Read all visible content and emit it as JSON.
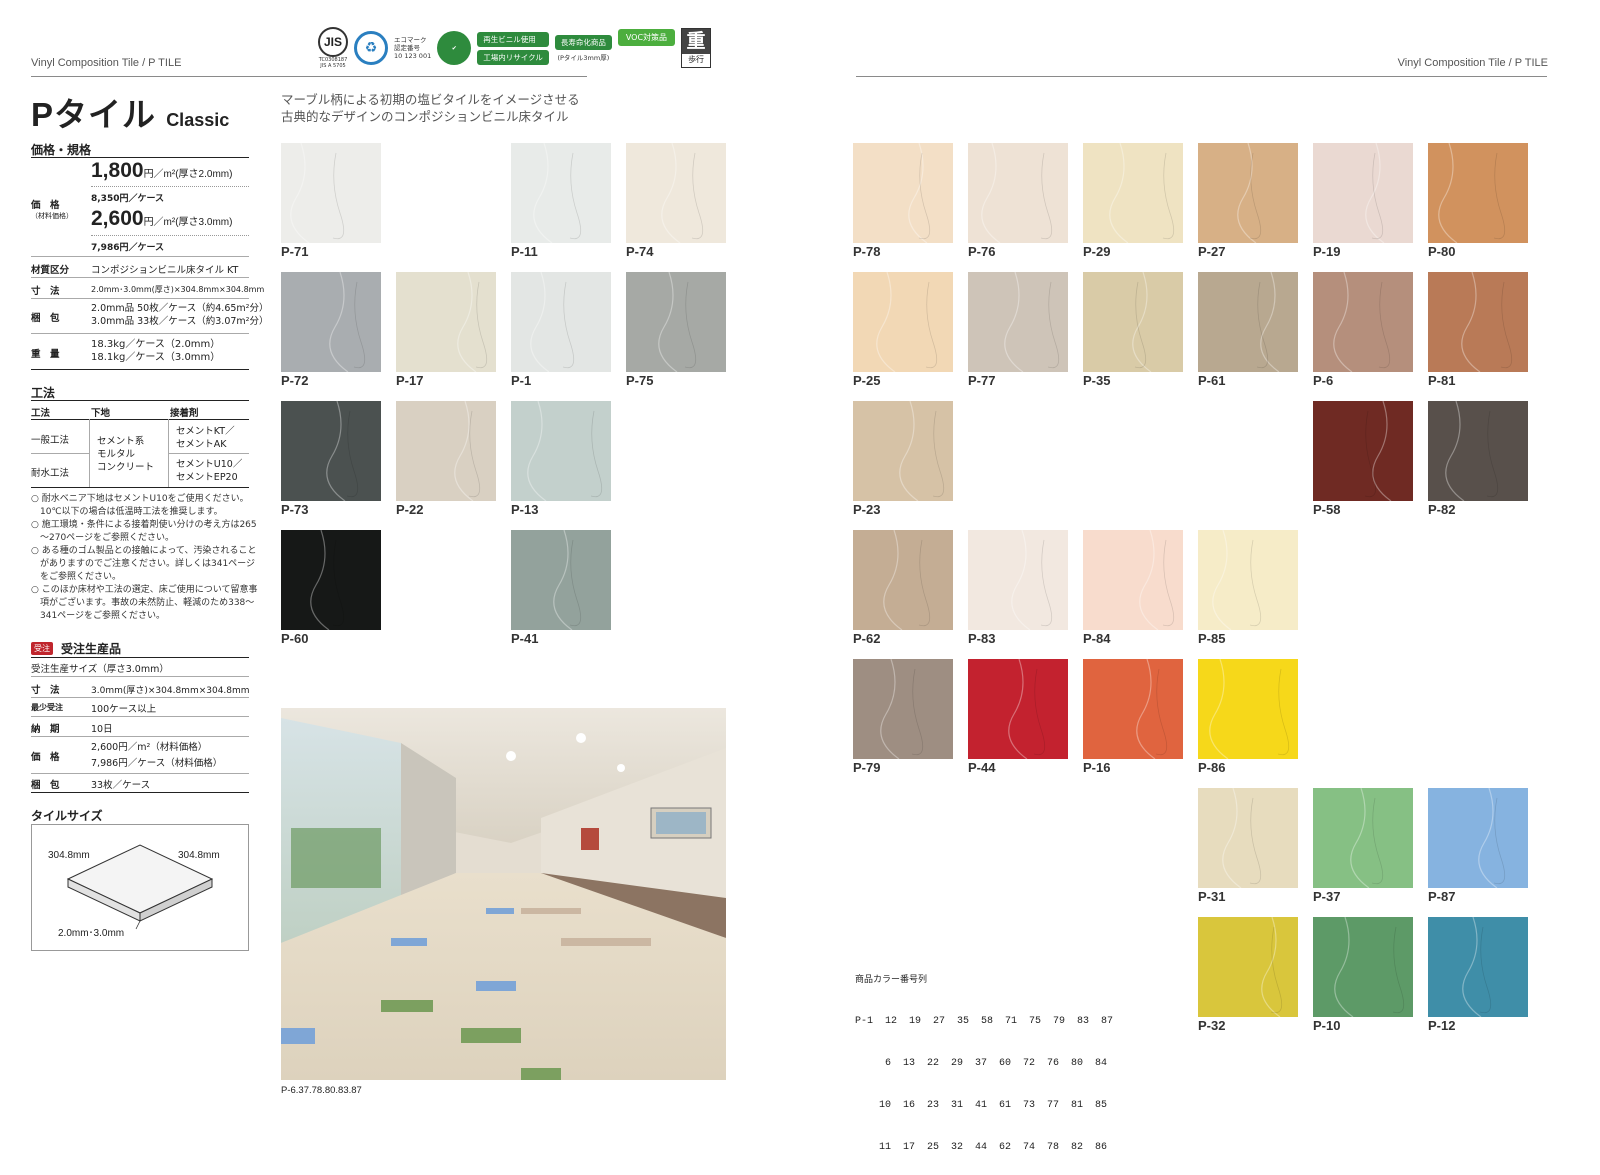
{
  "header": {
    "left_text": "Vinyl Composition Tile / P TILE",
    "right_text": "Vinyl Composition Tile / P TILE",
    "jis_mark": "JIS",
    "jis_code": "TC0308187",
    "jis_std": "JIS A 5705",
    "ecomark_label": "エコマーク",
    "ecomark_sub": "認定番号",
    "ecomark_number": "10 123 001",
    "badge_recycled": "再生ビニル使用",
    "badge_inplant": "工場内リサイクル",
    "badge_longlife": "長寿命化商品",
    "badge_longlife_note": "(Pタイル3mm厚)",
    "badge_voc": "VOC対策品",
    "heavy_big": "重",
    "heavy_small": "歩行"
  },
  "title": {
    "main": "Pタイル",
    "sub": "Classic"
  },
  "lead": {
    "line1": "マーブル柄による初期の塩ビタイルをイメージさせる",
    "line2": "古典的なデザインのコンポジションビニル床タイル"
  },
  "price_spec": {
    "heading": "価格・規格",
    "price_label": "価　格",
    "price_label_sub": "（材料価格）",
    "p1_big": "1,800",
    "p1_unit": "円／m²(厚さ2.0mm)",
    "p1_case": "8,350円／ケース",
    "p2_big": "2,600",
    "p2_unit": "円／m²(厚さ3.0mm)",
    "p2_case": "7,986円／ケース",
    "rows": [
      {
        "label": "材質区分",
        "value": "コンポジションビニル床タイル KT"
      },
      {
        "label": "寸　法",
        "value": "2.0mm･3.0mm(厚さ)×304.8mm×304.8mm"
      },
      {
        "label": "梱　包",
        "value": "2.0mm品 50枚／ケース（約4.65m²分）",
        "value2": "3.0mm品 33枚／ケース（約3.07m²分）"
      },
      {
        "label": "重　量",
        "value": "18.3kg／ケース（2.0mm）",
        "value2": "18.1kg／ケース（3.0mm）"
      }
    ]
  },
  "method": {
    "heading": "工法",
    "col1": "工法",
    "col2": "下地",
    "col3": "接着剤",
    "row1_method": "一般工法",
    "row2_method": "耐水工法",
    "base": "セメント系\nモルタル\nコンクリート",
    "row1_adh": "セメントKT／\nセメントAK",
    "row2_adh": "セメントU10／\nセメントEP20",
    "notes": [
      "○ 耐水ベニア下地はセメントU10をご使用ください。\n　10℃以下の場合は低温時工法を推奨します。",
      "○ 施工環境・条件による接着剤使い分けの考え方は265\n　～270ページをご参照ください。",
      "○ ある種のゴム製品との接触によって、汚染されること\n　がありますのでご注意ください。詳しくは341ページ\n　をご参照ください。",
      "○ このほか床材や工法の選定、床ご使用について留意事\n　項がございます。事故の未然防止、軽減のため338～\n　341ページをご参照ください。"
    ]
  },
  "order": {
    "badge": "受注",
    "heading": "受注生産品",
    "size_line": "受注生産サイズ（厚さ3.0mm）",
    "rows": [
      {
        "label": "寸　法",
        "value": "3.0mm(厚さ)×304.8mm×304.8mm"
      },
      {
        "label": "最少受注",
        "value": "100ケース以上"
      },
      {
        "label": "納　期",
        "value": "10日"
      },
      {
        "label": "価　格",
        "value": "2,600円／m²（材料価格）",
        "value2": "7,986円／ケース（材料価格）"
      },
      {
        "label": "梱　包",
        "value": "33枚／ケース"
      }
    ]
  },
  "tile_size": {
    "heading": "タイルサイズ",
    "dim_left": "304.8mm",
    "dim_right": "304.8mm",
    "dim_thick": "2.0mm･3.0mm"
  },
  "photo": {
    "caption": "P-6.37.78.80.83.87"
  },
  "color_index": {
    "heading": "商品カラー番号列",
    "rows": [
      "P-1  12  19  27  35  58  71  75  79  83  87",
      "     6  13  22  29  37  60  72  76  80  84",
      "    10  16  23  31  41  61  73  77  81  85",
      "    11  17  25  32  44  62  74  78  82  86"
    ]
  },
  "tiles": [
    {
      "code": "P-71",
      "color": "#ededea",
      "col": 0,
      "row": 0,
      "side": "L"
    },
    {
      "code": "P-11",
      "color": "#e8ebe9",
      "col": 2,
      "row": 0,
      "side": "L"
    },
    {
      "code": "P-74",
      "color": "#efe8dc",
      "col": 3,
      "row": 0,
      "side": "L"
    },
    {
      "code": "P-72",
      "color": "#a9adb0",
      "col": 0,
      "row": 1,
      "side": "L"
    },
    {
      "code": "P-17",
      "color": "#e4e0cf",
      "col": 1,
      "row": 1,
      "side": "L"
    },
    {
      "code": "P-1",
      "color": "#e3e6e4",
      "col": 2,
      "row": 1,
      "side": "L"
    },
    {
      "code": "P-75",
      "color": "#a6a9a5",
      "col": 3,
      "row": 1,
      "side": "L"
    },
    {
      "code": "P-73",
      "color": "#4b5150",
      "col": 0,
      "row": 2,
      "side": "L"
    },
    {
      "code": "P-22",
      "color": "#d9d0c2",
      "col": 1,
      "row": 2,
      "side": "L"
    },
    {
      "code": "P-13",
      "color": "#c3d0cc",
      "col": 2,
      "row": 2,
      "side": "L"
    },
    {
      "code": "P-60",
      "color": "#161817",
      "col": 0,
      "row": 3,
      "side": "L"
    },
    {
      "code": "P-41",
      "color": "#93a29c",
      "col": 2,
      "row": 3,
      "side": "L"
    },
    {
      "code": "P-78",
      "color": "#f3dfc6",
      "col": 0,
      "row": 0,
      "side": "R"
    },
    {
      "code": "P-76",
      "color": "#eee2d5",
      "col": 1,
      "row": 0,
      "side": "R"
    },
    {
      "code": "P-29",
      "color": "#efe3c2",
      "col": 2,
      "row": 0,
      "side": "R"
    },
    {
      "code": "P-27",
      "color": "#d7b086",
      "col": 3,
      "row": 0,
      "side": "R"
    },
    {
      "code": "P-19",
      "color": "#ead9d2",
      "col": 4,
      "row": 0,
      "side": "R"
    },
    {
      "code": "P-80",
      "color": "#d1925e",
      "col": 5,
      "row": 0,
      "side": "R"
    },
    {
      "code": "P-25",
      "color": "#f2d8b5",
      "col": 0,
      "row": 1,
      "side": "R"
    },
    {
      "code": "P-77",
      "color": "#cec4b8",
      "col": 1,
      "row": 1,
      "side": "R"
    },
    {
      "code": "P-35",
      "color": "#d9cba7",
      "col": 2,
      "row": 1,
      "side": "R"
    },
    {
      "code": "P-61",
      "color": "#b8a890",
      "col": 3,
      "row": 1,
      "side": "R"
    },
    {
      "code": "P-6",
      "color": "#b58f7c",
      "col": 4,
      "row": 1,
      "side": "R"
    },
    {
      "code": "P-81",
      "color": "#b97a57",
      "col": 5,
      "row": 1,
      "side": "R"
    },
    {
      "code": "P-23",
      "color": "#d6c2a6",
      "col": 0,
      "row": 2,
      "side": "R"
    },
    {
      "code": "P-58",
      "color": "#6f2a23",
      "col": 4,
      "row": 2,
      "side": "R"
    },
    {
      "code": "P-82",
      "color": "#58504b",
      "col": 5,
      "row": 2,
      "side": "R"
    },
    {
      "code": "P-62",
      "color": "#c4ad94",
      "col": 0,
      "row": 3,
      "side": "R"
    },
    {
      "code": "P-83",
      "color": "#f2e8e0",
      "col": 1,
      "row": 3,
      "side": "R"
    },
    {
      "code": "P-84",
      "color": "#f8dccd",
      "col": 2,
      "row": 3,
      "side": "R"
    },
    {
      "code": "P-85",
      "color": "#f6ecc8",
      "col": 3,
      "row": 3,
      "side": "R"
    },
    {
      "code": "P-79",
      "color": "#9e8e82",
      "col": 0,
      "row": 4,
      "side": "R"
    },
    {
      "code": "P-44",
      "color": "#c3222f",
      "col": 1,
      "row": 4,
      "side": "R"
    },
    {
      "code": "P-16",
      "color": "#e0643f",
      "col": 2,
      "row": 4,
      "side": "R"
    },
    {
      "code": "P-86",
      "color": "#f6d81a",
      "col": 3,
      "row": 4,
      "side": "R"
    },
    {
      "code": "P-31",
      "color": "#e7dcbe",
      "col": 3,
      "row": 5,
      "side": "R"
    },
    {
      "code": "P-37",
      "color": "#86c084",
      "col": 4,
      "row": 5,
      "side": "R"
    },
    {
      "code": "P-87",
      "color": "#86b3e0",
      "col": 5,
      "row": 5,
      "side": "R"
    },
    {
      "code": "P-32",
      "color": "#d9c63c",
      "col": 3,
      "row": 6,
      "side": "R"
    },
    {
      "code": "P-10",
      "color": "#5d9a67",
      "col": 4,
      "row": 6,
      "side": "R"
    },
    {
      "code": "P-12",
      "color": "#3f8ea8",
      "col": 5,
      "row": 6,
      "side": "R"
    }
  ]
}
